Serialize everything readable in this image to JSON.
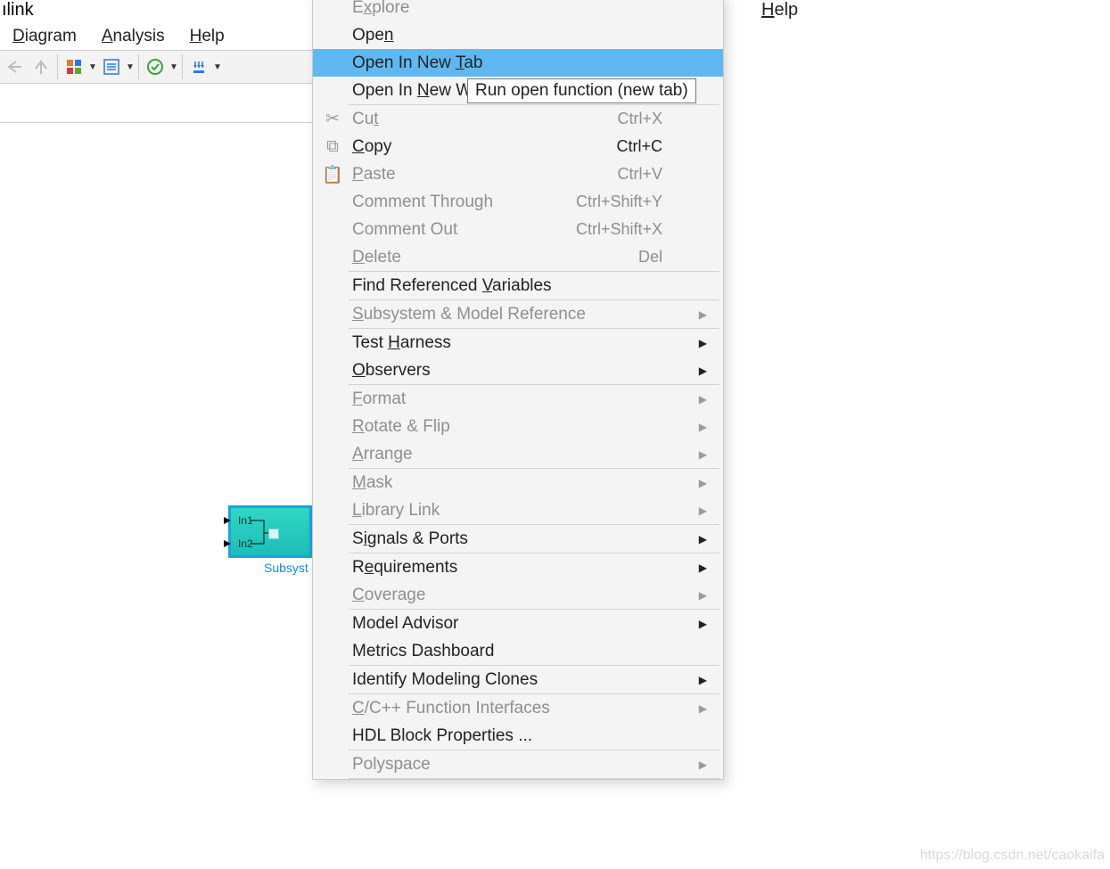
{
  "title_fragment": "ılink",
  "menubar": {
    "diagram": "Diagram",
    "analysis": "Analysis",
    "help": "Help"
  },
  "top_menu2": {
    "explore": "Explore",
    "help": "Help"
  },
  "block": {
    "in1": "In1",
    "in2": "In2",
    "caption": "Subsyst"
  },
  "tooltip": "Run open function (new tab)",
  "watermark": "https://blog.csdn.net/caokaifa",
  "ctx": {
    "explore": "Explore",
    "open": "Open",
    "open_new_tab": "Open In New Tab",
    "open_new_window": "Open In New Window",
    "cut": "Cut",
    "cut_sc": "Ctrl+X",
    "copy": "Copy",
    "copy_sc": "Ctrl+C",
    "paste": "Paste",
    "paste_sc": "Ctrl+V",
    "comment_through": "Comment Through",
    "comment_through_sc": "Ctrl+Shift+Y",
    "comment_out": "Comment Out",
    "comment_out_sc": "Ctrl+Shift+X",
    "delete": "Delete",
    "delete_sc": "Del",
    "find_ref_vars": "Find Referenced Variables",
    "subsys_modelref": "Subsystem & Model Reference",
    "test_harness": "Test Harness",
    "observers": "Observers",
    "format": "Format",
    "rotate_flip": "Rotate & Flip",
    "arrange": "Arrange",
    "mask": "Mask",
    "library_link": "Library Link",
    "signals_ports": "Signals & Ports",
    "requirements": "Requirements",
    "coverage": "Coverage",
    "model_advisor": "Model Advisor",
    "metrics_dashboard": "Metrics Dashboard",
    "identify_clones": "Identify Modeling Clones",
    "c_cpp_interfaces": "C/C++ Function Interfaces",
    "hdl_block_props": "HDL Block Properties ...",
    "polyspace": "Polyspace"
  }
}
